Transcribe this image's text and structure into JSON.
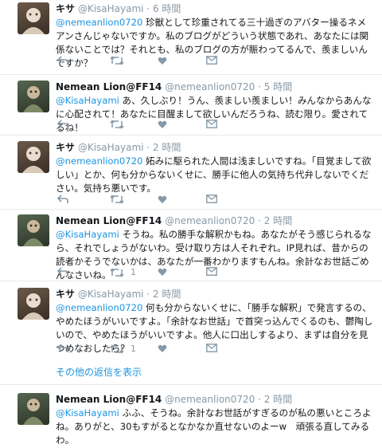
{
  "tweets": [
    {
      "author": "kisa",
      "name": "キサ",
      "handle": "@KisaHayami",
      "time": "· 6 時間",
      "mention": "@nemeanlion0720",
      "text": " 珍獣として珍重されてる三十過ぎのアバター操るネメアンさんじゃないですか。私のブログがどういう状態であれ、あなたには関係ないことでは？それとも、私のブログの方が賑わってるんで、羨ましいんですか？",
      "retweets": "",
      "likes": ""
    },
    {
      "author": "lion",
      "name": "Nemean Lion@FF14",
      "handle": "@nemeanlion0720",
      "time": "· 5 時間",
      "mention": "@KisaHayami",
      "text": " あ、久しぶり！うん、羨ましい羨ましい！みんなからあんなに心配されて！あなたに目醒まして欲しいんだろうね、読む限り。愛されてるね！",
      "retweets": "",
      "likes": ""
    },
    {
      "author": "kisa",
      "name": "キサ",
      "handle": "@KisaHayami",
      "time": "· 2 時間",
      "mention": "@nemeanlion0720",
      "text": " 妬みに駆られた人間は浅ましいですね。「目覚まして欲しい」とか、何も分からないくせに、勝手に他人の気持ち代弁しないでください。気持ち悪いです。",
      "retweets": "",
      "likes": ""
    },
    {
      "author": "lion",
      "name": "Nemean Lion@FF14",
      "handle": "@nemeanlion0720",
      "time": "· 2 時間",
      "mention": "@KisaHayami",
      "text": " そうね。私の勝手な解釈かもね。あなたがそう感じられるなら、それでしょうがないわ。受け取り方は人それぞれ。IP見れば、昔からの読者かそうでないかは、あなたが一番わかりますもんね。余計なお世話ごめんなさいね。",
      "retweets": "1",
      "likes": ""
    },
    {
      "author": "kisa",
      "name": "キサ",
      "handle": "@KisaHayami",
      "time": "· 2 時間",
      "mention": "@nemeanlion0720",
      "text": " 何も分からないくせに、「勝手な解釈」で発言するの、やめたほうがいいですよ。「余計なお世話」で首突っ込んでくるのも、鬱陶しいので、やめたほうがいいですよ。他人に口出しするより、まずは自分を見つめなおしたら？",
      "retweets": "1",
      "likes": ""
    },
    {
      "author": "lion",
      "name": "Nemean Lion@FF14",
      "handle": "@nemeanlion0720",
      "time": "· 2 時間",
      "mention": "@KisaHayami",
      "text": " ふふ、そうね。余計なお世話がすぎるのが私の悪いところよね。ありがと、30もすがるとなかなか直せないのよーw　頑張る直してみるわ。",
      "retweets": "",
      "likes": ""
    }
  ],
  "more_replies": "その他の返信を表示",
  "icons": {
    "reply": "reply-icon",
    "retweet": "retweet-icon",
    "like": "heart-icon",
    "dm": "envelope-icon"
  },
  "colors": {
    "link": "#1b95e0",
    "muted": "#8899a6",
    "divider": "#e6ecf0"
  }
}
